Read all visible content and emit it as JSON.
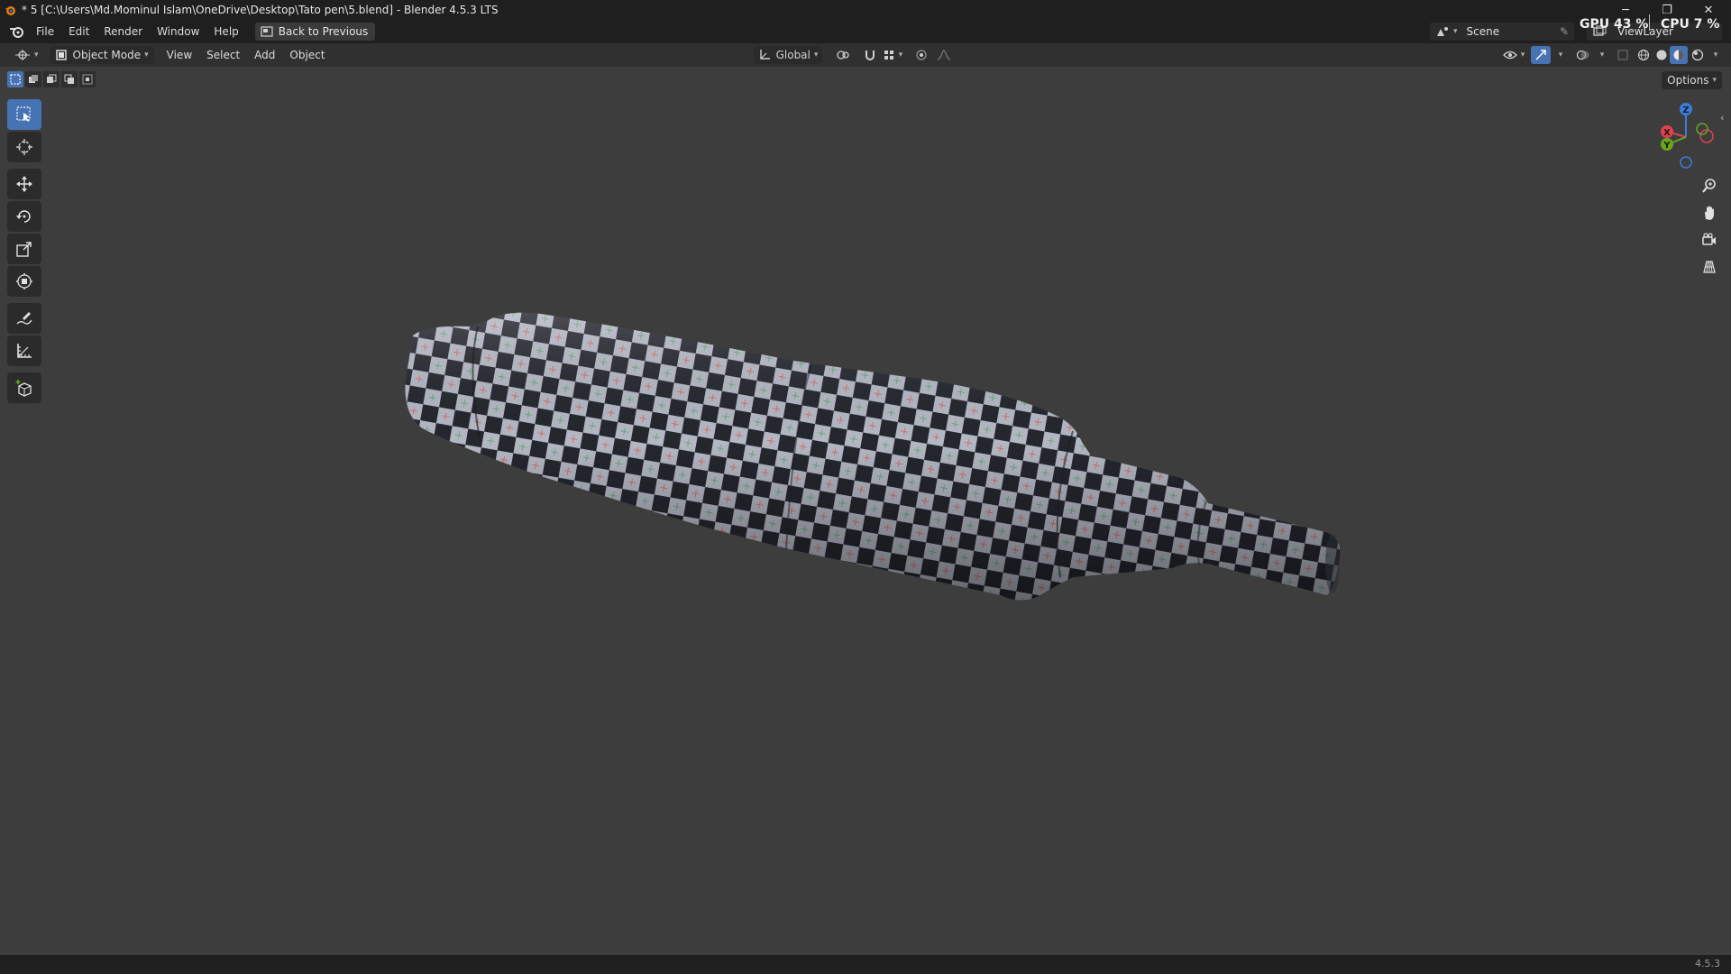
{
  "titlebar": {
    "title": "* 5 [C:\\Users\\Md.Mominul Islam\\OneDrive\\Desktop\\Tato pen\\5.blend] - Blender 4.5.3 LTS",
    "minimize": "─",
    "maximize": "❐",
    "close": "✕"
  },
  "menus": [
    "File",
    "Edit",
    "Render",
    "Window",
    "Help"
  ],
  "back_button": "Back to Previous",
  "scene": {
    "name": "Scene",
    "view_layer": "ViewLayer"
  },
  "perf": {
    "gpu": "GPU 43 %",
    "cpu": "CPU 7 %"
  },
  "viewheader": {
    "mode": "Object Mode",
    "menus": [
      "View",
      "Select",
      "Add",
      "Object"
    ],
    "transform_orientation": "Global"
  },
  "options_label": "Options",
  "toolbar_tools": [
    "select-box",
    "cursor",
    "move",
    "rotate",
    "scale",
    "transform",
    "annotate",
    "measure",
    "add-cube"
  ],
  "navigation_gizmo": {
    "x": "X",
    "y": "Y",
    "z": "Z"
  },
  "colors": {
    "accent": "#4772b3",
    "axis_x": "#e0424e",
    "axis_y": "#6ba51f",
    "axis_z": "#3d7cdb",
    "background": "#3d3d3d"
  },
  "status": {
    "version": "4.5.3"
  }
}
